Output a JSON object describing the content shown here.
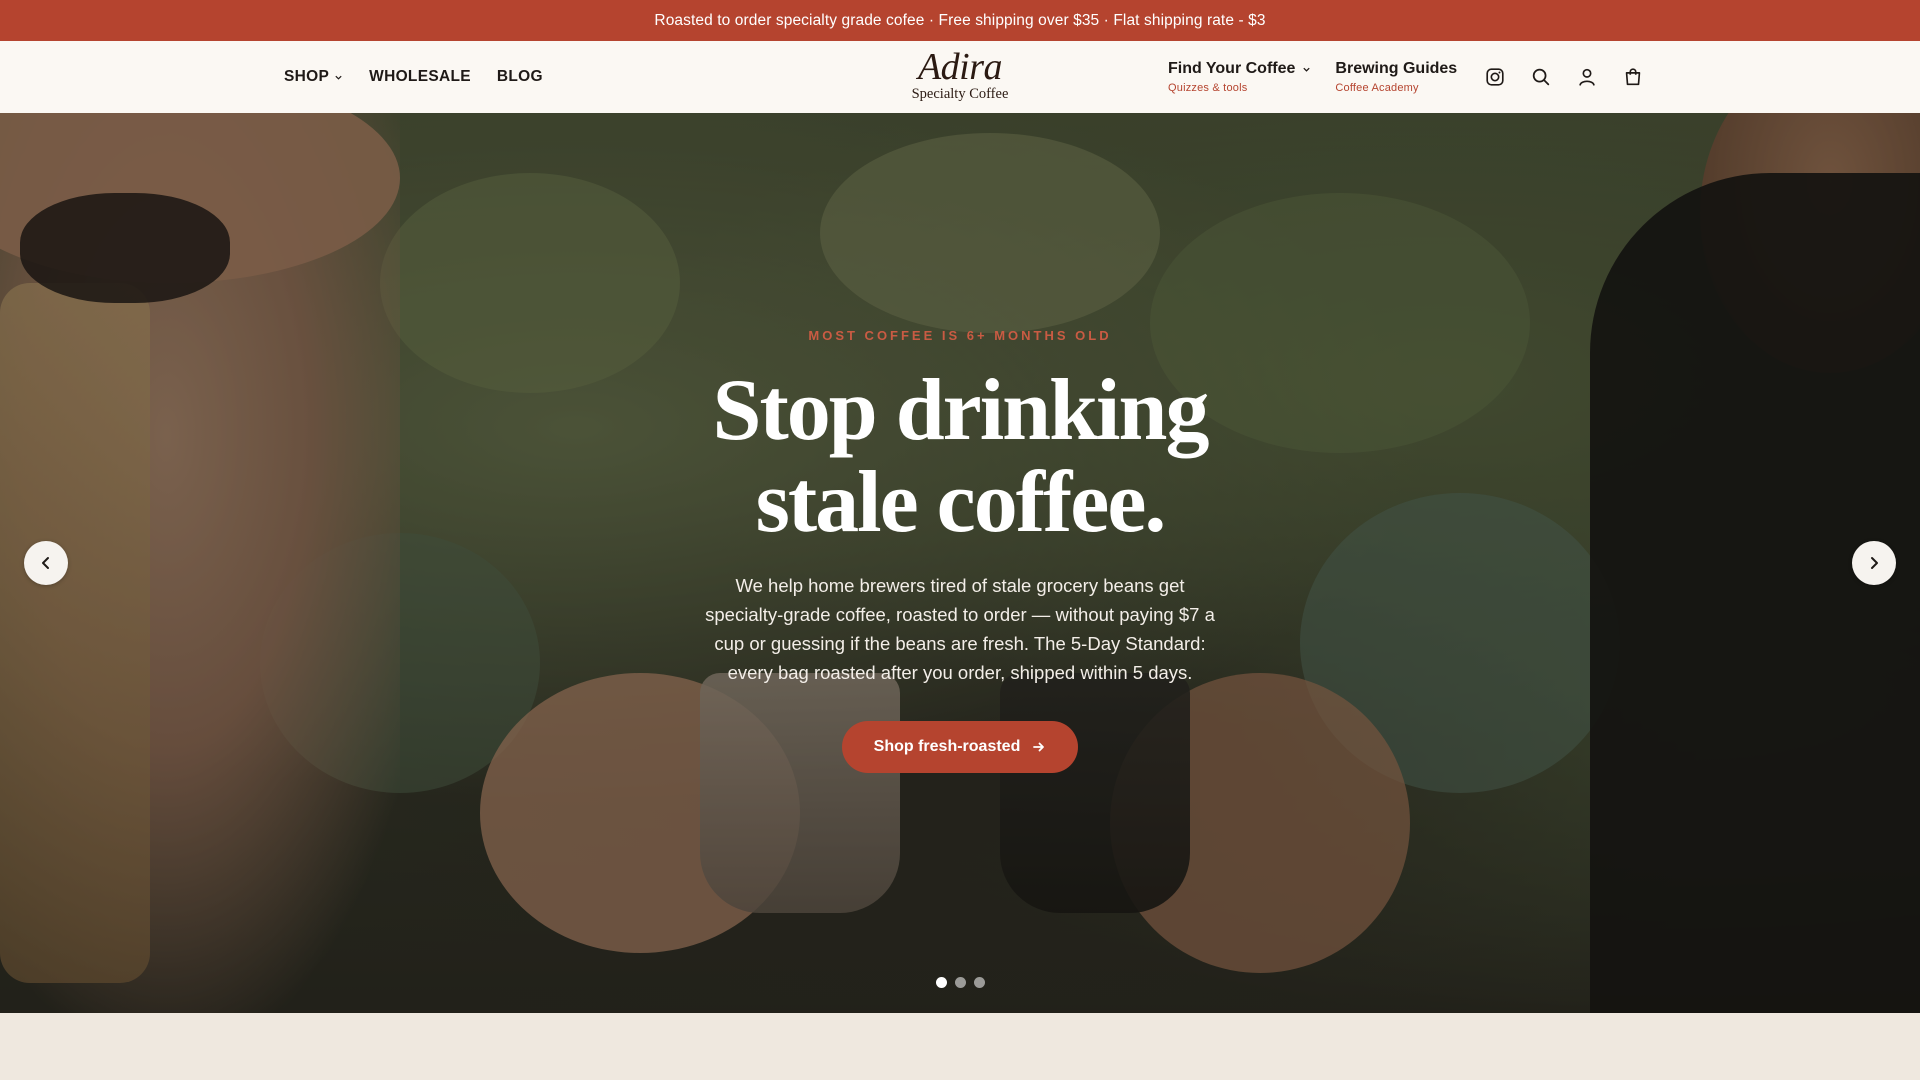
{
  "announcement": {
    "text": "Roasted to order specialty grade cofee · Free shipping over $35 · Flat shipping rate - $3"
  },
  "header": {
    "nav_left": [
      {
        "label": "SHOP",
        "has_dropdown": true
      },
      {
        "label": "WHOLESALE"
      },
      {
        "label": "BLOG"
      }
    ],
    "logo": {
      "name": "Adira",
      "tagline": "Specialty Coffee"
    },
    "nav_right": [
      {
        "label": "Find Your Coffee",
        "sublabel": "Quizzes & tools",
        "has_dropdown": true
      },
      {
        "label": "Brewing Guides",
        "sublabel": "Coffee Academy"
      }
    ],
    "icons": [
      "instagram-icon",
      "search-icon",
      "account-icon",
      "cart-icon"
    ]
  },
  "hero": {
    "eyebrow": "MOST COFFEE IS 6+ MONTHS OLD",
    "headline_line1": "Stop drinking",
    "headline_line2": "stale coffee.",
    "body": "We help home brewers tired of stale grocery beans get specialty-grade coffee, roasted to order — without paying $7 a cup or guessing if the beans are fresh. The 5-Day Standard: every bag roasted after you order, shipped within 5 days.",
    "cta_label": "Shop fresh-roasted",
    "slides_total": 3,
    "active_slide": 1
  },
  "colors": {
    "accent": "#b5442f",
    "header_bg": "#fbf8f3",
    "page_bg": "#efe8df",
    "text": "#1f1a17"
  }
}
